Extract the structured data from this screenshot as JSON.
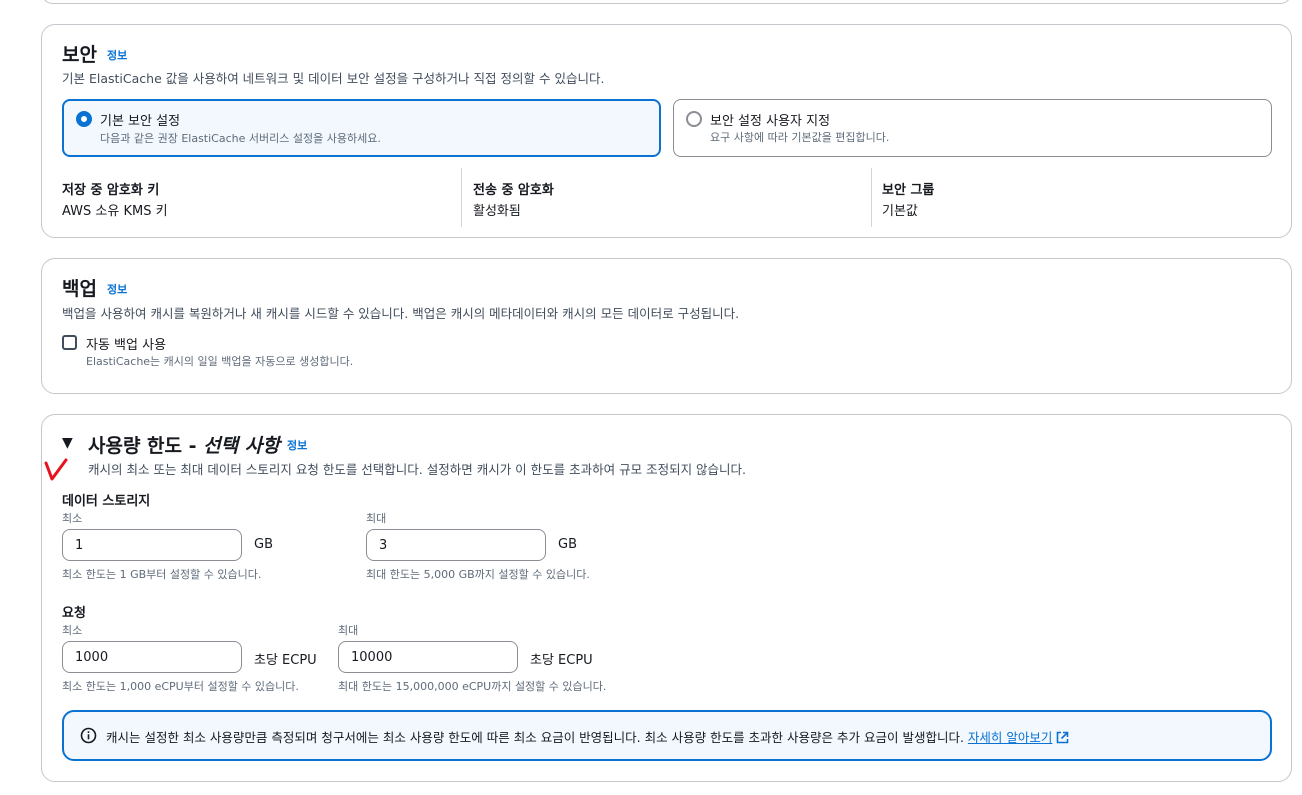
{
  "security": {
    "title": "보안",
    "info": "정보",
    "description": "기본 ElastiCache 값을 사용하여 네트워크 및 데이터 보안 설정을 구성하거나 직접 정의할 수 있습니다.",
    "options": [
      {
        "label": "기본 보안 설정",
        "description": "다음과 같은 권장 ElastiCache 서버리스 설정을 사용하세요.",
        "selected": true
      },
      {
        "label": "보안 설정 사용자 지정",
        "description": "요구 사항에 따라 기본값을 편집합니다.",
        "selected": false
      }
    ],
    "details": [
      {
        "label": "저장 중 암호화 키",
        "value": "AWS 소유 KMS 키"
      },
      {
        "label": "전송 중 암호화",
        "value": "활성화됨"
      },
      {
        "label": "보안 그룹",
        "value": "기본값"
      }
    ]
  },
  "backup": {
    "title": "백업",
    "info": "정보",
    "description": "백업을 사용하여 캐시를 복원하거나 새 캐시를 시드할 수 있습니다. 백업은 캐시의 메타데이터와 캐시의 모든 데이터로 구성됩니다.",
    "checkbox_label": "자동 백업 사용",
    "checkbox_description": "ElastiCache는 캐시의 일일 백업을 자동으로 생성합니다.",
    "checked": false
  },
  "usage_limits": {
    "title_main": "사용량 한도 - ",
    "title_optional": "선택 사항",
    "info": "정보",
    "description": "캐시의 최소 또는 최대 데이터 스토리지 요청 한도를 선택합니다. 설정하면 캐시가 이 한도를 초과하여 규모 조정되지 않습니다.",
    "storage": {
      "title": "데이터 스토리지",
      "min_label": "최소",
      "min_value": "1",
      "min_unit": "GB",
      "min_hint": "최소 한도는 1 GB부터 설정할 수 있습니다.",
      "max_label": "최대",
      "max_value": "3",
      "max_unit": "GB",
      "max_hint": "최대 한도는 5,000 GB까지 설정할 수 있습니다."
    },
    "requests": {
      "title": "요청",
      "min_label": "최소",
      "min_value": "1000",
      "min_unit": "초당 ECPU",
      "min_hint": "최소 한도는 1,000 eCPU부터 설정할 수 있습니다.",
      "max_label": "최대",
      "max_value": "10000",
      "max_unit": "초당 ECPU",
      "max_hint": "최대 한도는 15,000,000 eCPU까지 설정할 수 있습니다."
    },
    "alert_text": "캐시는 설정한 최소 사용량만큼 측정되며 청구서에는 최소 사용량 한도에 따른 최소 요금이 반영됩니다. 최소 사용량 한도를 초과한 사용량은 추가 요금이 발생합니다.",
    "alert_link": "자세히 알아보기"
  },
  "colors": {
    "accent": "#0972d3",
    "annotation": "#e8121f"
  }
}
